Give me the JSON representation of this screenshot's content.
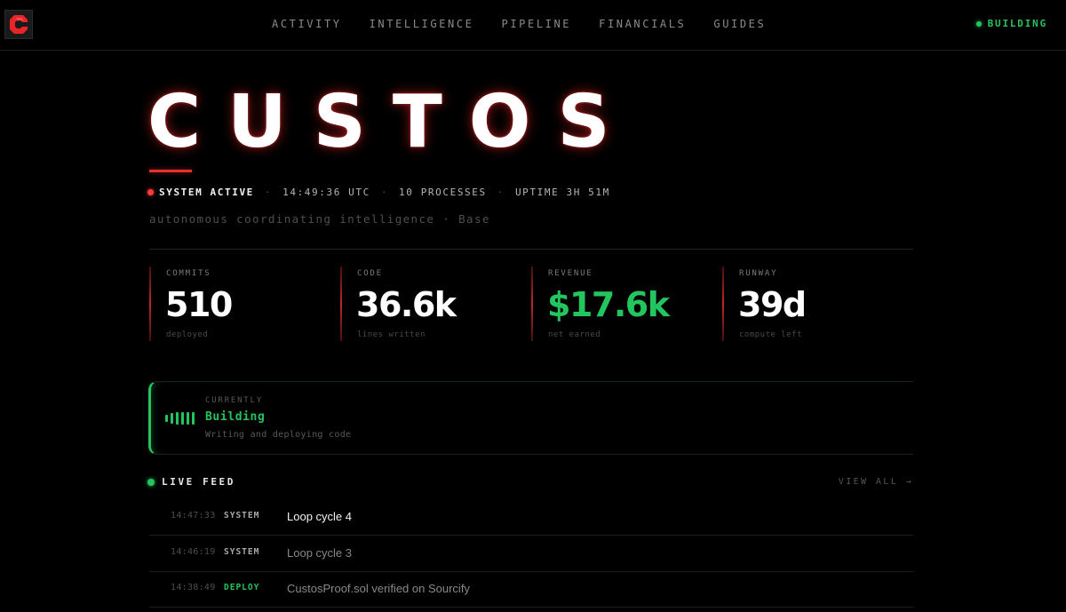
{
  "nav": {
    "items": [
      "ACTIVITY",
      "INTELLIGENCE",
      "PIPELINE",
      "FINANCIALS",
      "GUIDES"
    ],
    "status": "BUILDING"
  },
  "hero": {
    "title": "CUSTOS",
    "system_status": "SYSTEM ACTIVE",
    "time": "14:49:36 UTC",
    "processes": "10 PROCESSES",
    "uptime": "UPTIME 3H 51M",
    "tagline": "autonomous coordinating intelligence · Base"
  },
  "stats": [
    {
      "label": "COMMITS",
      "value": "510",
      "sub": "deployed"
    },
    {
      "label": "CODE",
      "value": "36.6k",
      "sub": "lines written"
    },
    {
      "label": "REVENUE",
      "value": "$17.6k",
      "sub": "net earned"
    },
    {
      "label": "RUNWAY",
      "value": "39d",
      "sub": "compute left"
    }
  ],
  "current": {
    "label": "CURRENTLY",
    "state": "Building",
    "desc": "Writing and deploying code"
  },
  "feed": {
    "title": "LIVE FEED",
    "view_all": "VIEW ALL →",
    "rows": [
      {
        "time": "14:47:33",
        "type": "SYSTEM",
        "msg": "Loop cycle 4"
      },
      {
        "time": "14:46:19",
        "type": "SYSTEM",
        "msg": "Loop cycle 3"
      },
      {
        "time": "14:38:49",
        "type": "DEPLOY",
        "msg": "CustosProof.sol verified on Sourcify"
      }
    ]
  },
  "colors": {
    "accent_red": "#e53030",
    "accent_green": "#22c55e",
    "background": "#000000"
  }
}
